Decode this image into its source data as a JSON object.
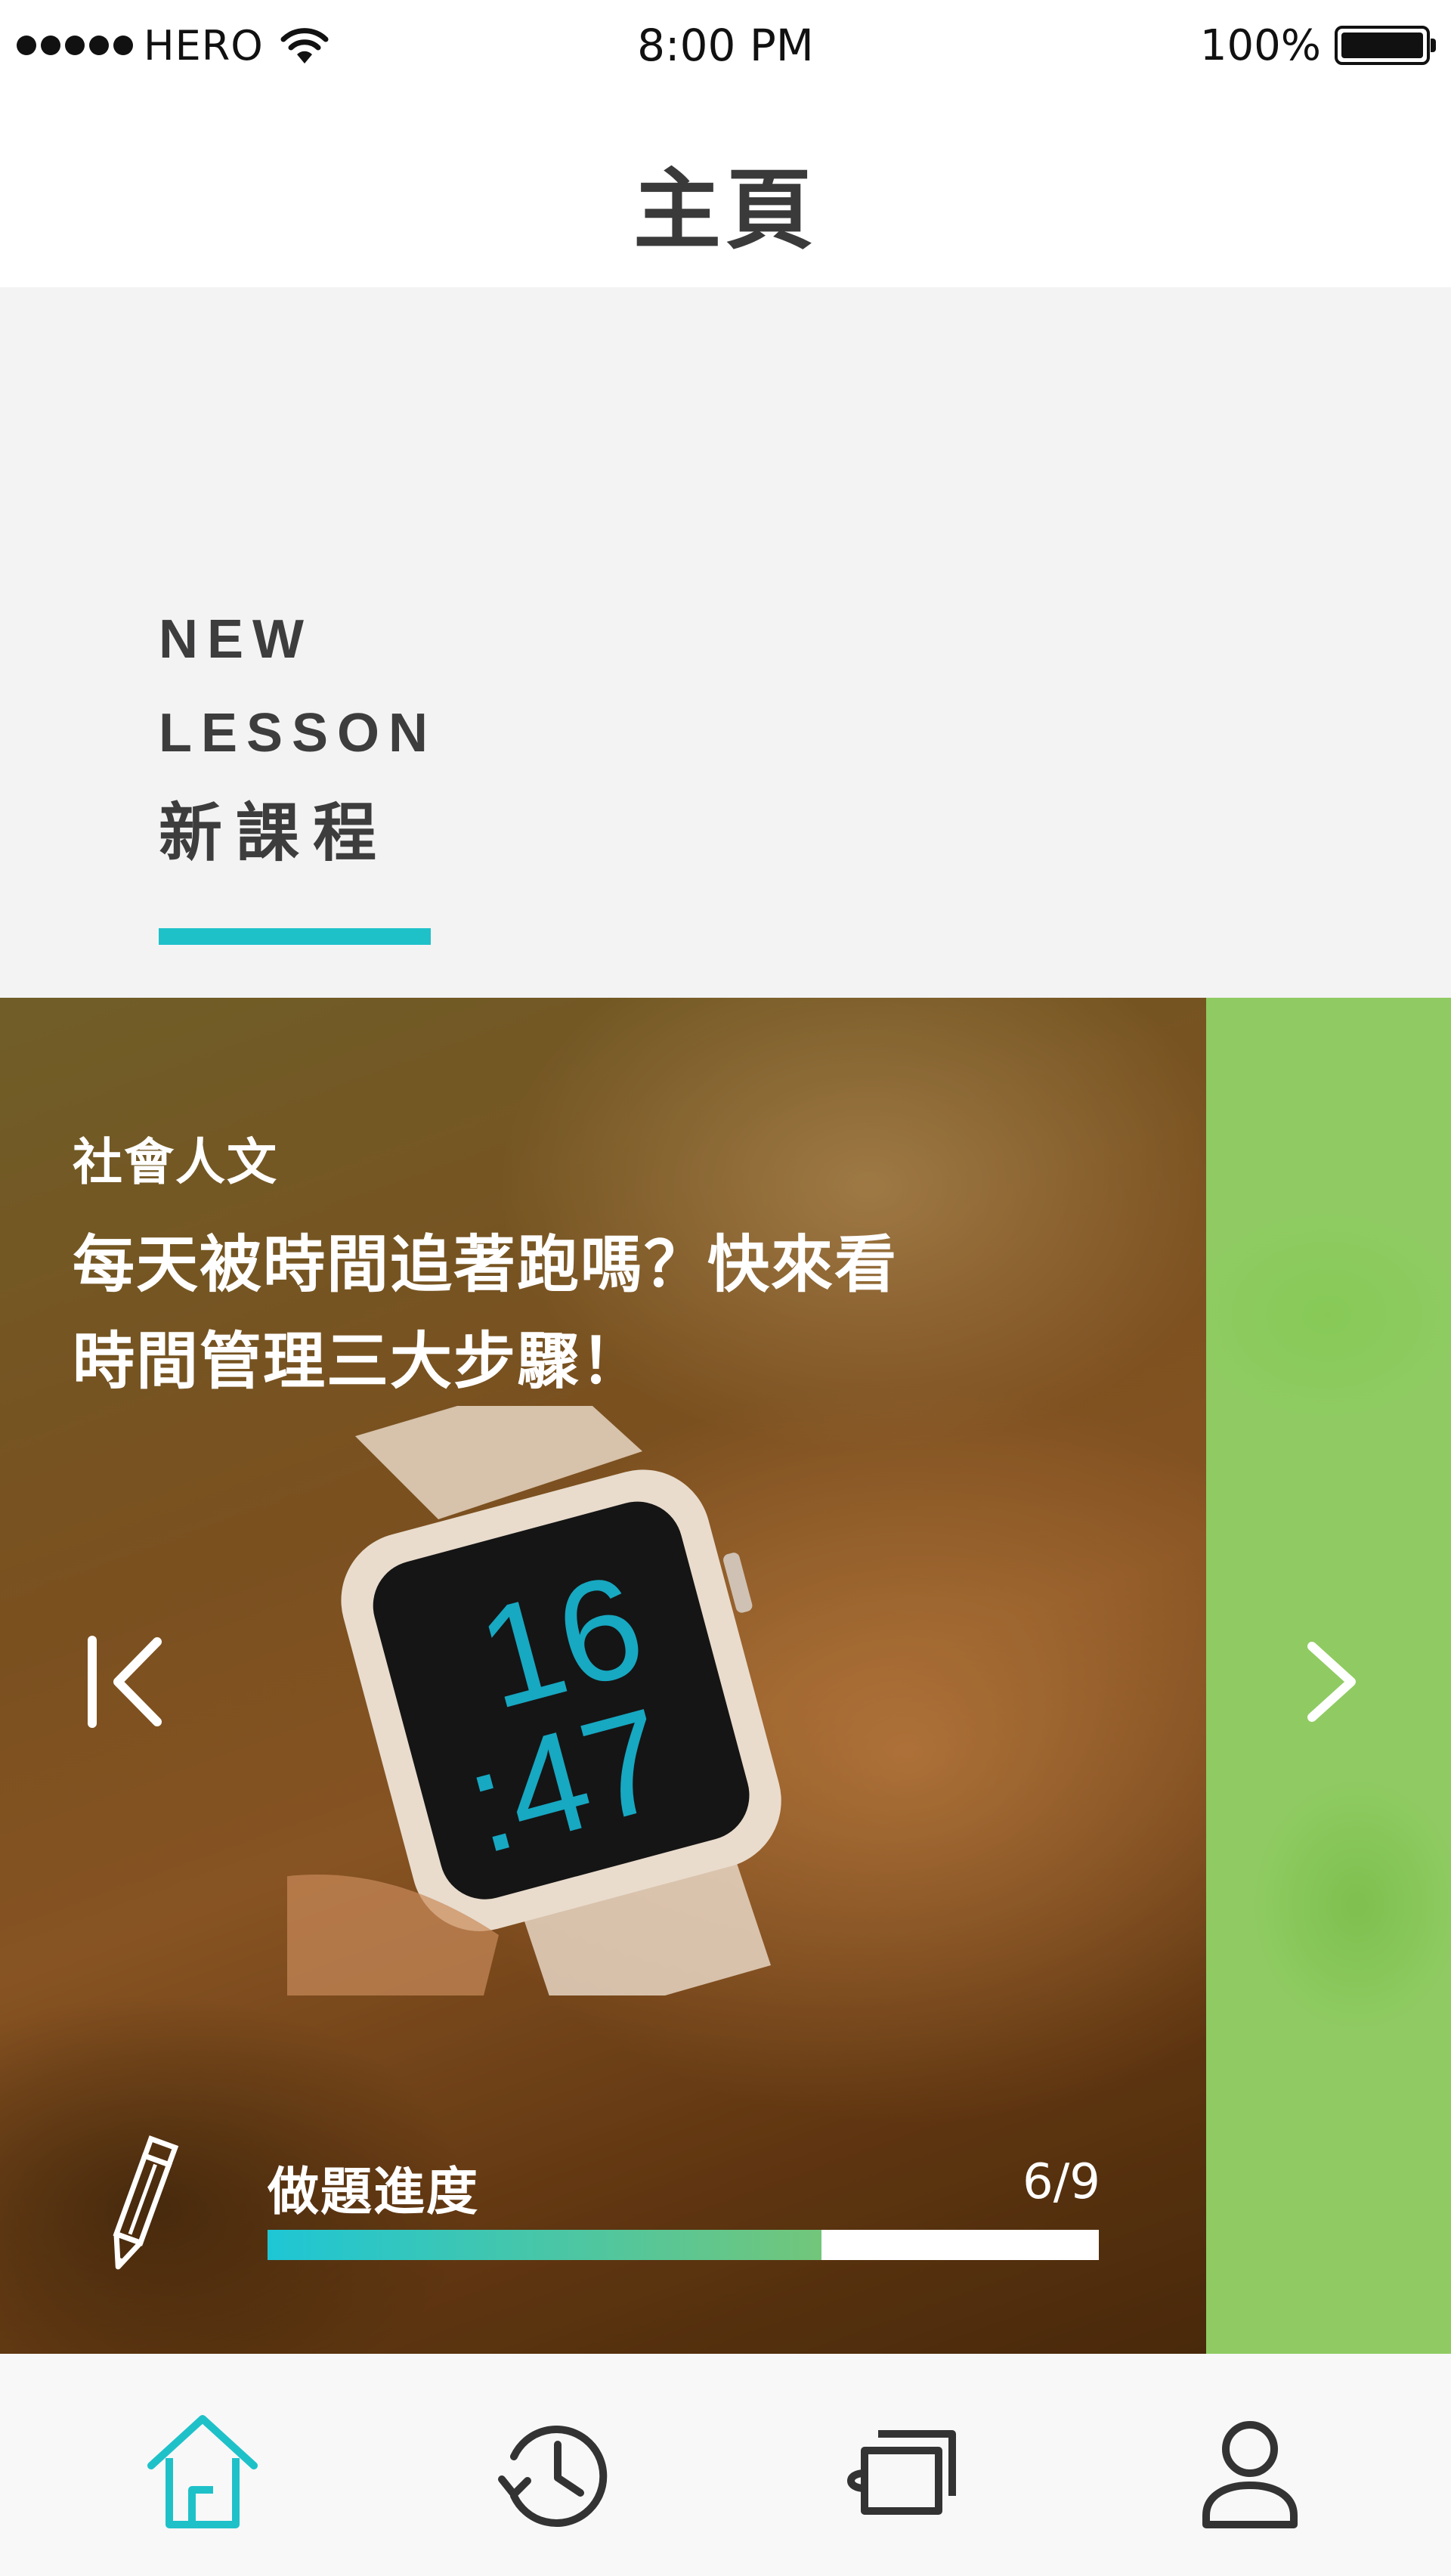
{
  "status_bar": {
    "carrier": "HERO",
    "time": "8:00 PM",
    "battery_percent": "100%"
  },
  "header": {
    "title": "主頁"
  },
  "section": {
    "title_en_line1": "NEW",
    "title_en_line2": "LESSON",
    "title_zh": "新課程",
    "accent_color": "#1fc1c9"
  },
  "lesson_card": {
    "category": "社會人文",
    "title_line1": "每天被時間追著跑嗎？快來看",
    "title_line2": "時間管理三大步驟！",
    "image_watch_display": "16:47",
    "progress": {
      "label": "做題進度",
      "count": "6/9",
      "fraction": 0.6667,
      "gradient_start": "#1ec6d5",
      "gradient_end": "#72c67a"
    },
    "prev_icon": "chevron-left-bar-icon",
    "next_icon": "chevron-right-icon",
    "pencil_icon": "pencil-icon"
  },
  "tab_bar": {
    "items": [
      {
        "name": "home",
        "icon": "home-icon",
        "active": true,
        "color": "#1fc1c9"
      },
      {
        "name": "history",
        "icon": "history-icon",
        "active": false,
        "color": "#333333"
      },
      {
        "name": "cards",
        "icon": "cards-icon",
        "active": false,
        "color": "#333333"
      },
      {
        "name": "profile",
        "icon": "profile-icon",
        "active": false,
        "color": "#333333"
      }
    ]
  }
}
